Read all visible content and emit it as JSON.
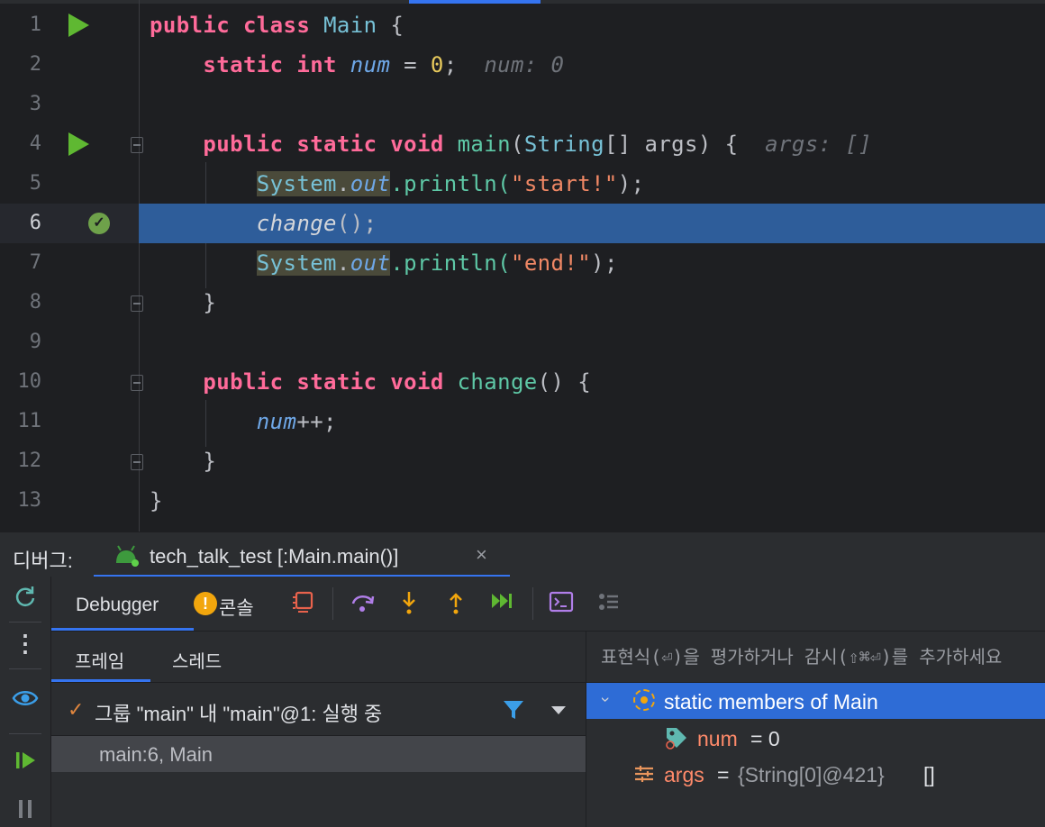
{
  "editor": {
    "lines": [
      {
        "n": "1"
      },
      {
        "n": "2"
      },
      {
        "n": "3"
      },
      {
        "n": "4"
      },
      {
        "n": "5"
      },
      {
        "n": "6"
      },
      {
        "n": "7"
      },
      {
        "n": "8"
      },
      {
        "n": "9"
      },
      {
        "n": "10"
      },
      {
        "n": "11"
      },
      {
        "n": "12"
      },
      {
        "n": "13"
      }
    ],
    "code": {
      "l1": {
        "kw": "public class",
        "cls": "Main",
        "rest": " {"
      },
      "l2": {
        "kw": "static int",
        "fld": "num",
        "op": " = ",
        "num": "0",
        "end": ";",
        "hint": "num: 0"
      },
      "l4": {
        "kw": "public static void",
        "fn": "main",
        "p1": "(",
        "cls": "String",
        "p2": "[] args) {",
        "hint": "args: []"
      },
      "l5": {
        "sys": "System",
        "dot": ".",
        "out": "out",
        "call": ".println(",
        "str": "\"start!\"",
        "end": ");"
      },
      "l6": {
        "call": "change",
        "end": "();"
      },
      "l7": {
        "sys": "System",
        "dot": ".",
        "out": "out",
        "call": ".println(",
        "str": "\"end!\"",
        "end": ");"
      },
      "l8": {
        "text": "}"
      },
      "l10": {
        "kw": "public static void",
        "fn": "change",
        "end": "() {"
      },
      "l11": {
        "fld": "num",
        "end": "++;"
      },
      "l12": {
        "text": "}"
      },
      "l13": {
        "text": "}"
      }
    },
    "current_line": 6
  },
  "debug": {
    "title": "디버그:",
    "session_label": "tech_talk_test [:Main.main()]",
    "session_close": "×",
    "tabs": {
      "debugger": "Debugger",
      "console": "콘솔",
      "console_badge": "!"
    },
    "frames_tabs": {
      "frames": "프레임",
      "threads": "스레드"
    },
    "thread": {
      "check": "✓",
      "label": "그룹 \"main\" 내 \"main\"@1: 실행 중"
    },
    "frame": {
      "label": "main:6, Main"
    },
    "eval_placeholder": "표현식(⏎)을 평가하거나 감시(⇧⌘⏎)를 추가하세요",
    "variables": {
      "static_label": "static members of Main",
      "chevron": "›",
      "num_name": "num",
      "num_value": " = 0",
      "args_name": "args",
      "args_eq": "=",
      "args_type": "{String[0]@421}",
      "args_value": "[]"
    }
  },
  "colors": {
    "accent": "#3574f0",
    "run_green": "#5fb832",
    "selection": "#2e5d9a",
    "keyword": "#ff6b9a",
    "warning": "#f2a60d"
  },
  "icons": [
    "run-icon",
    "breakpoint-check-icon",
    "fold-icon",
    "android-session-icon",
    "rerun-icon",
    "more-icon",
    "watch-eye-icon",
    "resume-icon",
    "pause-icon",
    "stop-frames-icon",
    "step-over-icon",
    "step-into-icon",
    "step-out-icon",
    "run-to-cursor-icon",
    "evaluate-icon",
    "threads-icon",
    "filter-icon",
    "dropdown-icon",
    "static-members-icon",
    "field-tag-icon",
    "args-icon"
  ]
}
